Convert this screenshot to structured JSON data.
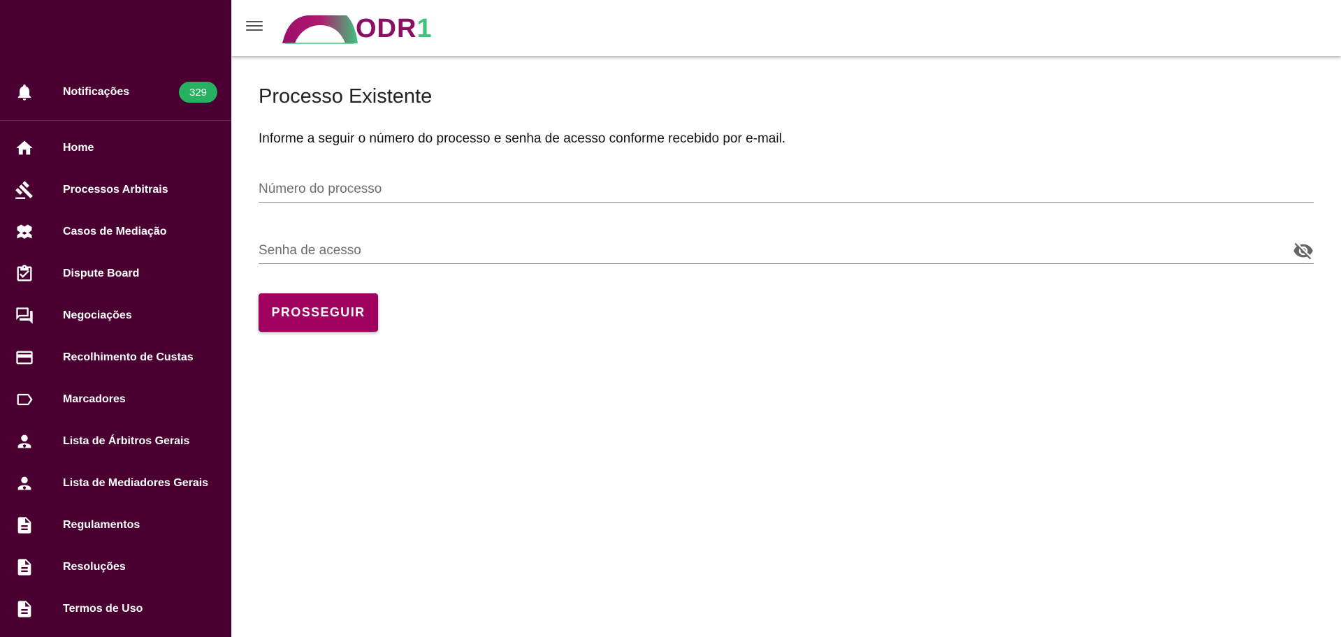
{
  "sidebar": {
    "notifications": {
      "label": "Notificações",
      "count": "329",
      "icon": "bell-icon"
    },
    "items": [
      {
        "label": "Home",
        "icon": "home-icon"
      },
      {
        "label": "Processos Arbitrais",
        "icon": "gavel-icon"
      },
      {
        "label": "Casos de Mediação",
        "icon": "handshake-icon"
      },
      {
        "label": "Dispute Board",
        "icon": "clipboard-check-icon"
      },
      {
        "label": "Negociações",
        "icon": "chat-icon"
      },
      {
        "label": "Recolhimento de Custas",
        "icon": "credit-card-icon"
      },
      {
        "label": "Marcadores",
        "icon": "label-icon"
      },
      {
        "label": "Lista de Árbitros Gerais",
        "icon": "person-icon"
      },
      {
        "label": "Lista de Mediadores Gerais",
        "icon": "person-icon"
      },
      {
        "label": "Regulamentos",
        "icon": "document-icon"
      },
      {
        "label": "Resoluções",
        "icon": "document-icon"
      },
      {
        "label": "Termos de Uso",
        "icon": "document-icon"
      }
    ]
  },
  "header": {
    "logo": {
      "text_main": "ODR",
      "text_accent": "1"
    }
  },
  "main": {
    "title": "Processo Existente",
    "description": "Informe a seguir o número do processo e senha de acesso conforme recebido por e-mail.",
    "process_number_placeholder": "Número do processo",
    "password_placeholder": "Senha de acesso",
    "submit_label": "PROSSEGUIR"
  },
  "colors": {
    "sidebar_bg": "#4a0030",
    "badge_bg": "#27b261",
    "button_bg": "#a0005e",
    "logo_primary": "#8a0f62",
    "logo_accent": "#3dc47a"
  }
}
